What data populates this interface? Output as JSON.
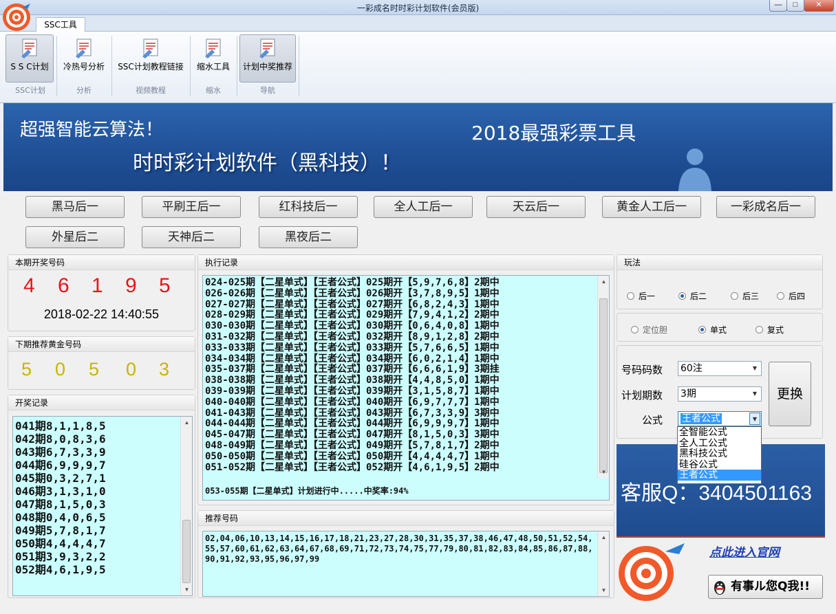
{
  "window": {
    "title": "一彩成名时时彩计划软件(会员版)",
    "min": "—",
    "max": "□",
    "close": "✕"
  },
  "tabs": [
    {
      "label": "SSC工具"
    }
  ],
  "ribbon": {
    "buttons": [
      {
        "label": "S S C计划"
      },
      {
        "label": "冷热号分析"
      },
      {
        "label": "SSC计划教程链接"
      },
      {
        "label": "缩水工具"
      },
      {
        "label": "计划中奖推荐"
      }
    ],
    "groups": [
      "SSC计划",
      "分析",
      "视频教程",
      "缩水",
      "导航"
    ]
  },
  "banner": {
    "line1": "超强智能云算法！",
    "line2": "时时彩计划软件（黑科技）！",
    "line3": "2018最强彩票工具"
  },
  "plans": [
    "黑马后一",
    "平刷王后一",
    "红科技后一",
    "全人工后一",
    "天云后一",
    "黄金人工后一",
    "一彩成名后一",
    "外星后二",
    "天神后二",
    "黑夜后二"
  ],
  "current": {
    "title": "本期开奖号码",
    "digits": [
      "4",
      "6",
      "1",
      "9",
      "5"
    ],
    "time": "2018-02-22 14:40:55"
  },
  "next": {
    "title": "下期推荐黄金号码",
    "digits": [
      "5",
      "0",
      "5",
      "0",
      "3"
    ]
  },
  "history": {
    "title": "开奖记录",
    "items": [
      "041期8,1,1,8,5",
      "042期8,0,8,3,6",
      "043期6,7,3,3,9",
      "044期6,9,9,9,7",
      "045期0,3,2,7,1",
      "046期3,1,3,1,0",
      "047期8,1,5,0,3",
      "048期0,4,0,6,5",
      "049期5,7,8,1,7",
      "050期4,4,4,4,7",
      "051期3,9,3,2,2",
      "052期4,6,1,9,5"
    ]
  },
  "exec": {
    "title": "执行记录",
    "lines": [
      "024-025期【二星单式】【王者公式】025期开【5,9,7,6,8】2期中",
      "026-026期【二星单式】【王者公式】026期开【3,7,8,9,5】1期中",
      "027-027期【二星单式】【王者公式】027期开【6,8,2,4,3】1期中",
      "028-029期【二星单式】【王者公式】029期开【7,9,4,1,2】2期中",
      "030-030期【二星单式】【王者公式】030期开【0,6,4,0,8】1期中",
      "031-032期【二星单式】【王者公式】032期开【8,9,1,2,8】2期中",
      "033-033期【二星单式】【王者公式】033期开【5,7,6,6,5】1期中",
      "034-034期【二星单式】【王者公式】034期开【6,0,2,1,4】1期中",
      "035-037期【二星单式】【王者公式】037期开【6,6,6,1,9】3期挂",
      "038-038期【二星单式】【王者公式】038期开【4,4,8,5,0】1期中",
      "039-039期【二星单式】【王者公式】039期开【3,1,5,8,7】1期中",
      "040-040期【二星单式】【王者公式】040期开【6,9,7,7,7】1期中",
      "041-043期【二星单式】【王者公式】043期开【6,7,3,3,9】3期中",
      "044-044期【二星单式】【王者公式】044期开【6,9,9,9,7】1期中",
      "045-047期【二星单式】【王者公式】047期开【8,1,5,0,3】3期中",
      "048-049期【二星单式】【王者公式】049期开【5,7,8,1,7】2期中",
      "050-050期【二星单式】【王者公式】050期开【4,4,4,4,7】1期中",
      "051-052期【二星单式】【王者公式】052期开【4,6,1,9,5】2期中"
    ],
    "status": "053-055期【二星单式】计划进行中.....中奖率:94%"
  },
  "rec": {
    "title": "推荐号码",
    "text": "02,04,06,10,13,14,15,16,17,18,21,23,27,28,30,31,35,37,38,46,47,48,50,51,52,54,55,57,60,61,62,63,64,67,68,69,71,72,73,74,75,77,79,80,81,82,83,84,85,86,87,88,90,91,92,93,95,96,97,99"
  },
  "play": {
    "title": "玩法",
    "modes": [
      "后一",
      "后二",
      "后三",
      "后四"
    ],
    "selected_mode": "后二",
    "types": [
      "定位胆",
      "单式",
      "复式"
    ],
    "selected_type": "单式"
  },
  "settings": {
    "count_label": "号码码数",
    "count_value": "60注",
    "period_label": "计划期数",
    "period_value": "3期",
    "formula_label": "公式",
    "formula_value": "王者公式",
    "swap": "更换"
  },
  "formula_options": [
    "全智能公式",
    "全人工公式",
    "黑科技公式",
    "硅谷公式",
    "王者公式"
  ],
  "service": {
    "text": "客服Q：3404501163",
    "link": "点此进入官网",
    "qq_button": "有事ル您Q我!!"
  },
  "colors": {
    "red": "#e8141a",
    "gold": "#c8b400",
    "cyan": "#ccfefe",
    "banner": "#2a5fa8"
  }
}
